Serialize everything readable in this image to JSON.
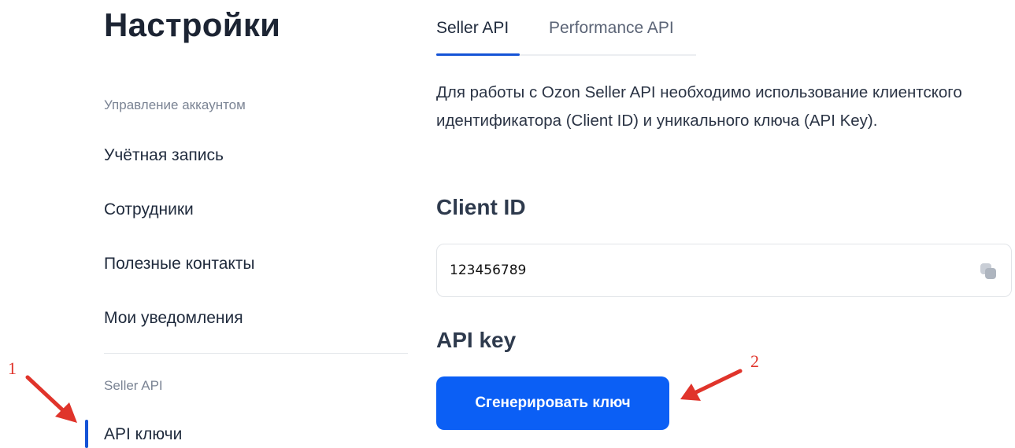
{
  "page_title": "Настройки",
  "sidebar": {
    "section_account": "Управление аккаунтом",
    "items": [
      {
        "label": "Учётная запись"
      },
      {
        "label": "Сотрудники"
      },
      {
        "label": "Полезные контакты"
      },
      {
        "label": "Мои уведомления"
      }
    ],
    "section_api": "Seller API",
    "api_items": [
      {
        "label": "API ключи",
        "active": true
      }
    ]
  },
  "tabs": [
    {
      "label": "Seller API",
      "active": true
    },
    {
      "label": "Performance API",
      "active": false
    }
  ],
  "description": "Для работы с Ozon Seller API необходимо использование клиентского идентификатора (Client ID) и уникального ключа (API Key).",
  "client_id": {
    "heading": "Client ID",
    "value": "123456789",
    "icon": "copy-icon"
  },
  "api_key": {
    "heading": "API key",
    "button_label": "Сгенерировать ключ"
  },
  "annotations": [
    {
      "label": "1",
      "color": "#e0342b"
    },
    {
      "label": "2",
      "color": "#e0342b"
    }
  ],
  "colors": {
    "accent": "#1453d6",
    "button": "#0b5ff5",
    "annotation": "#e0342b"
  }
}
